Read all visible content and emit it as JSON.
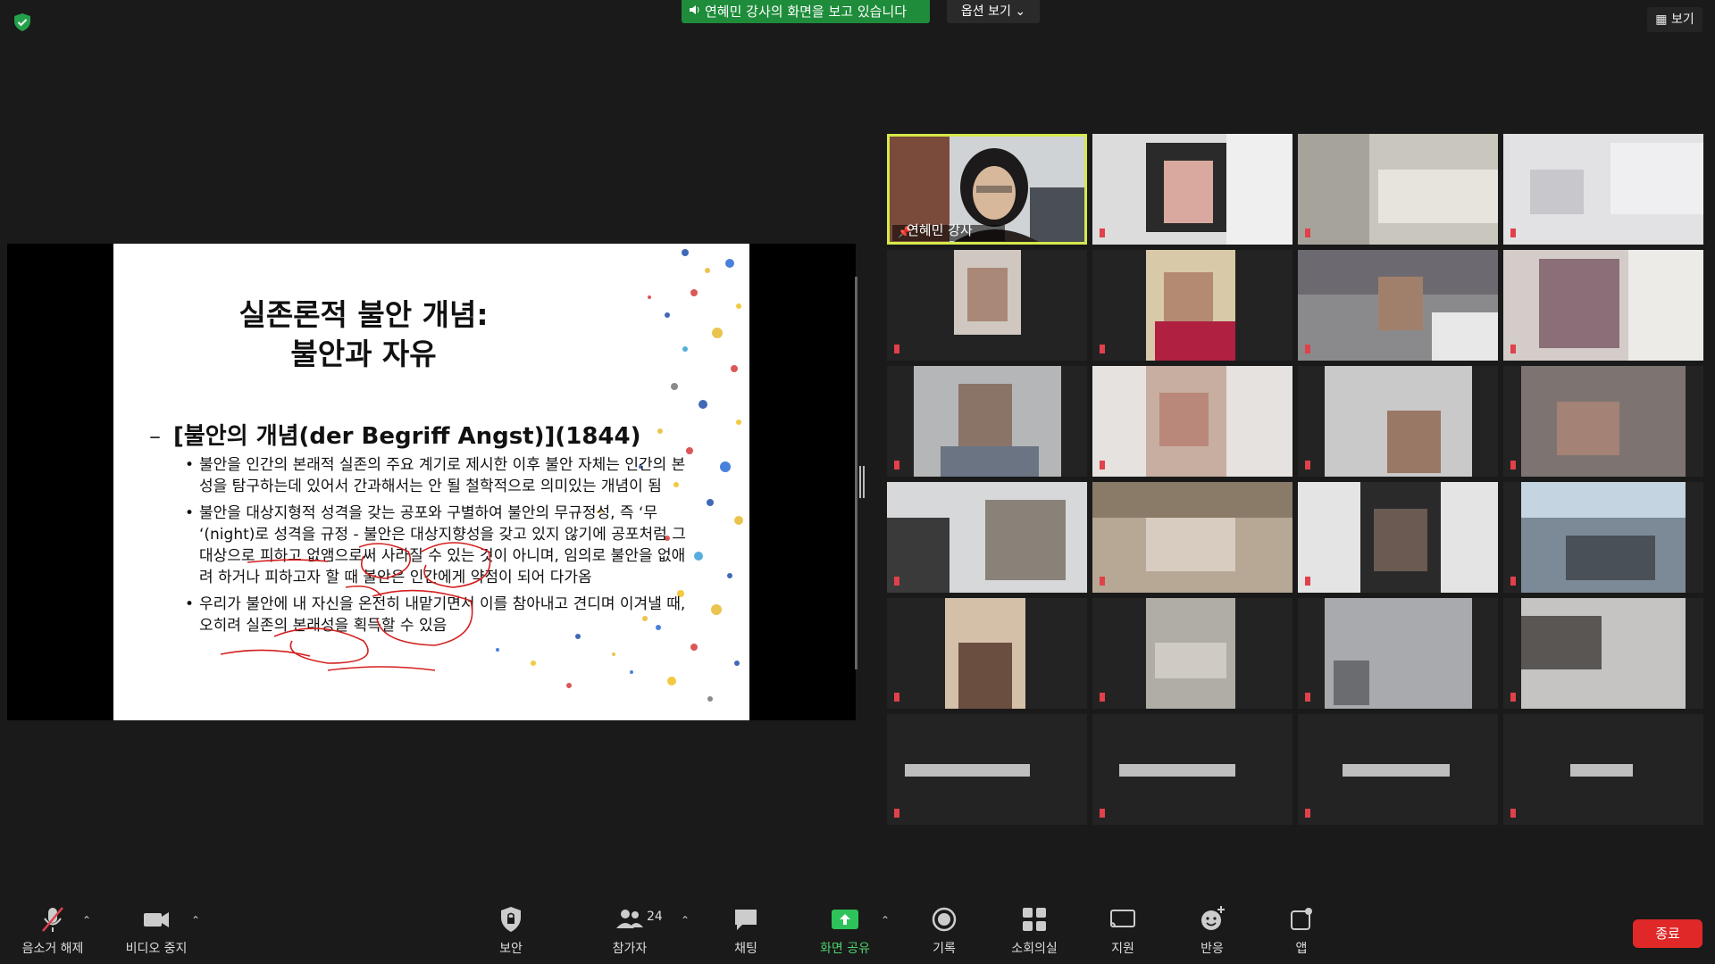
{
  "top": {
    "banner_text": "연혜민 강사의 화면을 보고 있습니다",
    "view_options_label": "옵션 보기",
    "view_label": "보기"
  },
  "slide": {
    "title_line1": "실존론적 불안 개념:",
    "title_line2": "불안과 자유",
    "heading": "[불안의 개념(der Begriff Angst)](1844)",
    "bullets": [
      "불안을 인간의 본래적 실존의 주요 계기로 제시한 이후 불안 자체는 인간의 본성을 탐구하는데 있어서 간과해서는 안 될 철학적으로 의미있는 개념이 됨",
      "불안을 대상지형적 성격을 갖는 공포와 구별하여 불안의 무규정성, 즉 ‘무 ‘(night)로 성격을 규정 - 불안은 대상지향성을 갖고 있지 않기에 공포처럼 그 대상으로 피하고 없앰으로써 사라질 수 있는 것이 아니며, 임의로 불안을 없애려 하거나 피하고자 할 때 불안은 인간에게 약점이 되어 다가옴",
      "우리가 불안에 내 자신을 온전히 내맡기면서 이를 참아내고 견디며 이겨낼 때, 오히려 실존의 본래성을 획득할 수 있음"
    ]
  },
  "gallery": {
    "active_speaker_name": "연혜민 강사"
  },
  "toolbar": {
    "mute_label": "음소거 해제",
    "video_label": "비디오 중지",
    "security_label": "보안",
    "participants_label": "참가자",
    "participants_count": "24",
    "chat_label": "채팅",
    "share_label": "화면 공유",
    "record_label": "기록",
    "breakout_label": "소회의실",
    "support_label": "지원",
    "reactions_label": "반응",
    "apps_label": "앱",
    "end_label": "종료"
  },
  "colors": {
    "accent_green": "#1e8c3a",
    "active_border": "#d6e94b",
    "end_red": "#e02828"
  }
}
